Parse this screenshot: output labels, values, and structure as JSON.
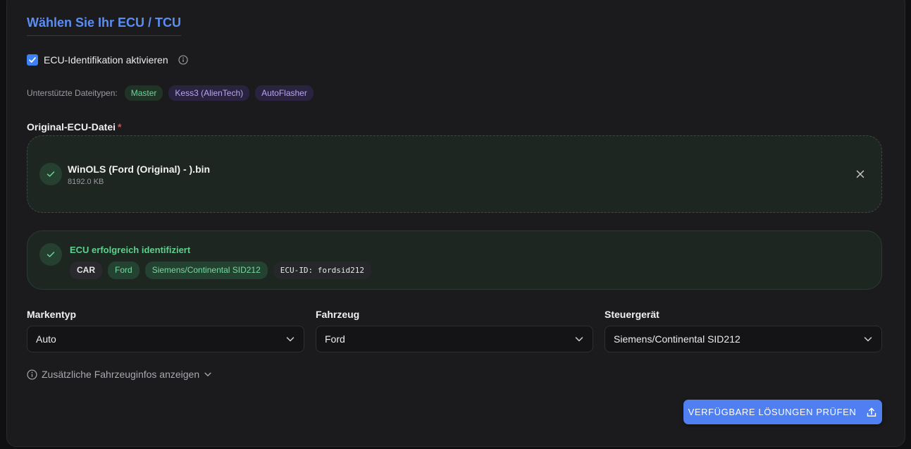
{
  "title": "Wählen Sie Ihr ECU / TCU",
  "ecu_identification": {
    "label": "ECU-Identifikation aktivieren",
    "checked": true
  },
  "supported_types": {
    "label": "Unterstützte Dateitypen:",
    "tags": [
      "Master",
      "Kess3 (AlienTech)",
      "AutoFlasher"
    ]
  },
  "file_section": {
    "label": "Original-ECU-Datei",
    "required_mark": "*",
    "file_name": "WinOLS (Ford (Original) - ).bin",
    "file_size": "8192.0 KB"
  },
  "identification": {
    "title": "ECU erfolgreich identifiziert",
    "tags": [
      "CAR",
      "Ford",
      "Siemens/Continental SID212",
      "ECU-ID: fordsid212"
    ]
  },
  "fields": {
    "brand_type": {
      "label": "Markentyp",
      "value": "Auto"
    },
    "vehicle": {
      "label": "Fahrzeug",
      "value": "Ford"
    },
    "control_unit": {
      "label": "Steuergerät",
      "value": "Siemens/Continental SID212"
    }
  },
  "more_info_label": "Zusätzliche Fahrzeuginfos anzeigen",
  "primary_button": "VERFÜGBARE LÖSUNGEN PRÜFEN",
  "icons": {
    "checkbox": "check-icon",
    "info": "info-icon",
    "success": "check-icon",
    "close": "close-icon",
    "dropdown": "chevron-down-icon",
    "upload": "upload-icon"
  },
  "colors": {
    "accent": "#5b8ef5",
    "button": "#4f7ff0",
    "success": "#5fcf8c",
    "required": "#e5484d"
  }
}
